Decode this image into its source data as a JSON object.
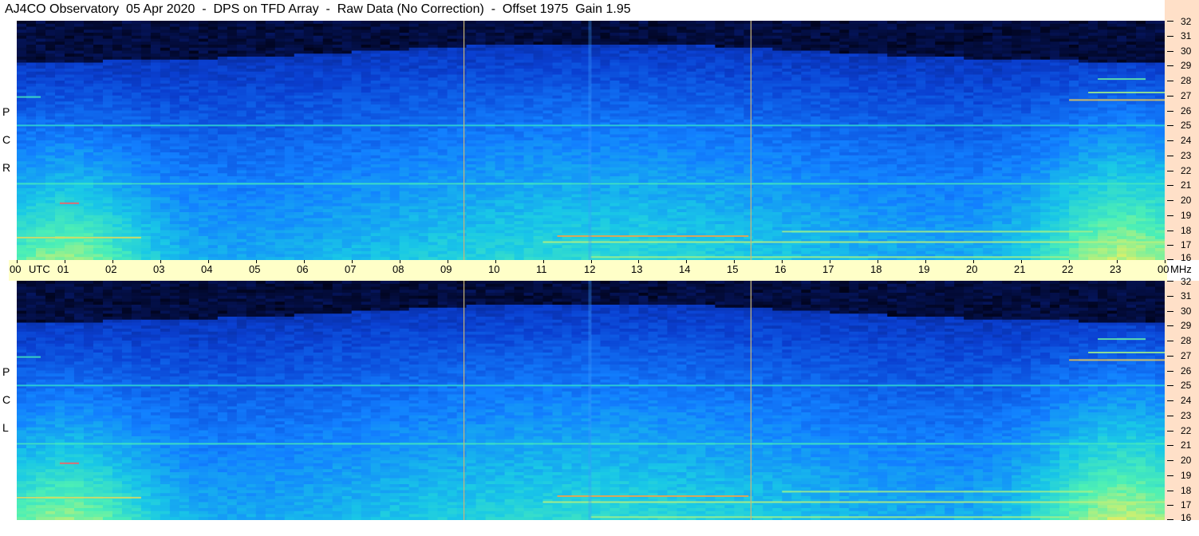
{
  "title": "AJ4CO Observatory  05 Apr 2020  -  DPS on TFD Array  -  Raw Data (No Correction)  -  Offset 1975  Gain 1.95",
  "chart_data": {
    "type": "heatmap",
    "title": "AJ4CO Observatory  05 Apr 2020  -  DPS on TFD Array  -  Raw Data (No Correction)  -  Offset 1975  Gain 1.95",
    "x_axis": {
      "labels": [
        "00",
        "UTC",
        "01",
        "02",
        "03",
        "04",
        "05",
        "06",
        "07",
        "08",
        "09",
        "10",
        "11",
        "12",
        "13",
        "14",
        "15",
        "16",
        "17",
        "18",
        "19",
        "20",
        "21",
        "22",
        "23",
        "00",
        "MHz"
      ],
      "hours": [
        "00",
        "01",
        "02",
        "03",
        "04",
        "05",
        "06",
        "07",
        "08",
        "09",
        "10",
        "11",
        "12",
        "13",
        "14",
        "15",
        "16",
        "17",
        "18",
        "19",
        "20",
        "21",
        "22",
        "23",
        "00"
      ],
      "unit_label": "UTC",
      "end_unit": "MHz",
      "range": [
        0,
        24
      ]
    },
    "y_axis": {
      "ticks": [
        "32",
        "31",
        "30",
        "29",
        "28",
        "27",
        "26",
        "25",
        "24",
        "23",
        "22",
        "21",
        "20",
        "19",
        "18",
        "17",
        "16"
      ],
      "range": [
        16,
        32
      ],
      "unit": "MHz"
    },
    "panels": [
      {
        "name": "RCP",
        "letters": [
          "P",
          "C",
          "R"
        ]
      },
      {
        "name": "LCP",
        "letters": [
          "P",
          "C",
          "L"
        ]
      }
    ],
    "markers_utc": [
      9.35,
      15.35
    ],
    "colormap": [
      "#000010",
      "#061a6e",
      "#0a3fd0",
      "#1280ff",
      "#19c8e6",
      "#4ef0b4",
      "#d8f06a",
      "#ff8c3c",
      "#ff3c78"
    ],
    "grid": false
  }
}
